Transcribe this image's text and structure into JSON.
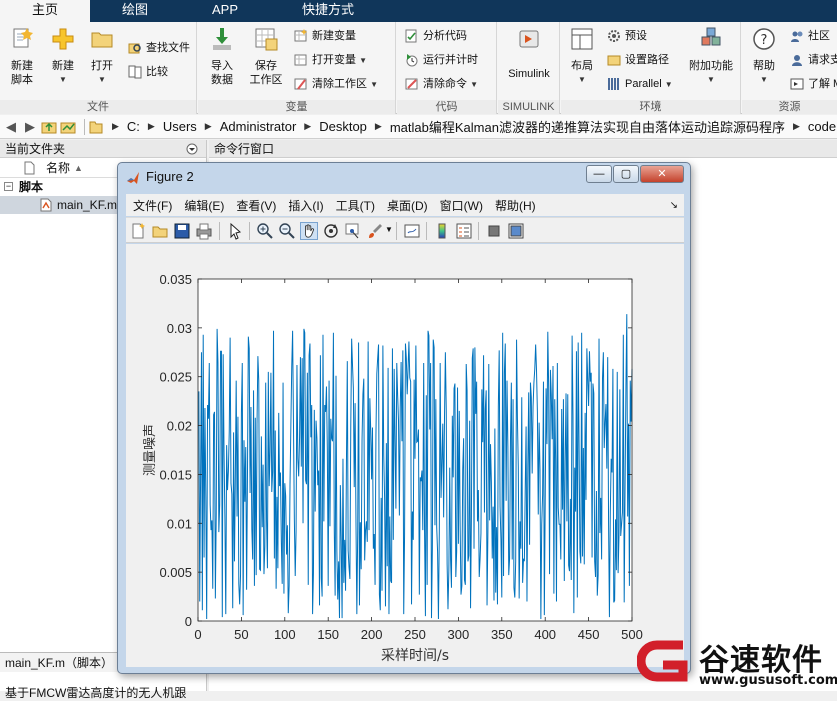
{
  "tabs": [
    "主页",
    "绘图",
    "APP",
    "快捷方式"
  ],
  "ribbon": {
    "file": {
      "label": "文件",
      "new_script": [
        "新建",
        "脚本"
      ],
      "new": "新建",
      "open": "打开",
      "find_files": "查找文件",
      "compare": "比较"
    },
    "variable": {
      "label": "变量",
      "import": [
        "导入",
        "数据"
      ],
      "save_ws": [
        "保存",
        "工作区"
      ],
      "new_var": "新建变量",
      "open_var": "打开变量",
      "clear_ws": "清除工作区"
    },
    "code": {
      "label": "代码",
      "analyze": "分析代码",
      "run_time": "运行并计时",
      "clear_cmd": "清除命令"
    },
    "simulink": {
      "label": "SIMULINK",
      "btn": "Simulink"
    },
    "env": {
      "label": "环境",
      "layout": "布局",
      "prefs": "预设",
      "set_path": "设置路径",
      "parallel": "Parallel",
      "addons": "附加功能"
    },
    "resources": {
      "label": "资源",
      "help": "帮助",
      "community": "社区",
      "request": "请求支",
      "learn": "了解 M"
    }
  },
  "address": [
    "C:",
    "Users",
    "Administrator",
    "Desktop",
    "matlab编程Kalman滤波器的递推算法实现自由落体运动追踪源码程序",
    "code"
  ],
  "current_folder": {
    "title": "当前文件夹",
    "col_name": "名称",
    "col_sort": "▲",
    "group": "脚本",
    "file": "main_KF.m",
    "details_title": "main_KF.m（脚本）",
    "details_text": "基于FMCW雷达高度计的无人机跟"
  },
  "command_window": {
    "title": "命令行窗口"
  },
  "figure": {
    "title": "Figure 2",
    "menus": [
      "文件(F)",
      "编辑(E)",
      "查看(V)",
      "插入(I)",
      "工具(T)",
      "桌面(D)",
      "窗口(W)",
      "帮助(H)"
    ]
  },
  "chart_data": {
    "type": "line",
    "title": "",
    "xlabel": "采样时间/s",
    "ylabel": "测量噪声",
    "xlim": [
      0,
      500
    ],
    "ylim": [
      0,
      0.035
    ],
    "xticks": [
      0,
      50,
      100,
      150,
      200,
      250,
      300,
      350,
      400,
      450,
      500
    ],
    "yticks": [
      0,
      0.005,
      0.01,
      0.015,
      0.02,
      0.025,
      0.03,
      0.035
    ],
    "ytick_labels": [
      "0",
      "0.005",
      "0.01",
      "0.015",
      "0.02",
      "0.025",
      "0.03",
      "0.035"
    ],
    "color": "#0072bd",
    "series": [
      {
        "x_start": 1,
        "x_step": 1,
        "values": [
          0.0235,
          0.002,
          0.015,
          0.0275,
          0.0011,
          0.0293,
          0.0065,
          0.0218,
          0.0127,
          0.0002,
          0.0221,
          0.0207,
          0.0264,
          0.0119,
          0.0093,
          0.0103,
          0.0033,
          0.0211,
          0.0214,
          0.0023,
          0.0109,
          0.0299,
          0.0264,
          0.0091,
          0.0119,
          0.0276,
          0.0276,
          0.0004,
          0.0273,
          0.0172,
          0.0105,
          0.0007,
          0.018,
          0.0134,
          0.0153,
          0.0194,
          0.029,
          0.0141,
          0.013,
          0.0013,
          0.0193,
          0.0061,
          0.0146,
          0.0246,
          0.0107,
          0.0209,
          0.0038,
          0.0017,
          0.0047,
          0.0213,
          0.0264,
          0.0006,
          0.0185,
          0.0122,
          0.0178,
          0.0032,
          0.015,
          0.0291,
          0.0279,
          0.0131,
          0.0219,
          0.0094,
          0.0063,
          0.0236,
          0.0036,
          0.0208,
          0.0047,
          0.0202,
          0.0271,
          0.0246,
          0.0053,
          0.0052,
          0.0189,
          0.0096,
          0.016,
          0.0048,
          0.0076,
          0.0244,
          0.0102,
          0.0054,
          0.0255,
          0.0138,
          0.0173,
          0.0254,
          0.0132,
          0.0153,
          0.0297,
          0.0064,
          0.0195,
          0.0033,
          0.0127,
          0.0054,
          0.0213,
          0.0138,
          0.0152,
          0.0081,
          0.0038,
          0.0244,
          0.0028,
          0.0141,
          0.0128,
          0.0068,
          0.0098,
          0.0008,
          0.0036,
          0.0139,
          0.0201,
          0.026,
          0.0297,
          0.0201,
          0.0104,
          0.0046,
          0.0092,
          0.0262,
          0.0166,
          0.0148,
          0.0188,
          0.027,
          0.0158,
          0.0269,
          0.01,
          0.0299,
          0.0295,
          0.0144,
          0.014,
          0.0254,
          0.0037,
          0.0272,
          0.0284,
          0.0188,
          0.0221,
          0.0007,
          0.0049,
          0.0216,
          0.0112,
          0.0205,
          0.0187,
          0.0139,
          0.0154,
          0.0016,
          0.0272,
          0.0044,
          0.0025,
          0.0293,
          0.0102,
          0.0221,
          0.0214,
          0.024,
          0.0176,
          0.0036,
          0.0246,
          0.0097,
          0.0207,
          0.0187,
          0.0184,
          0.0295,
          0.0092,
          0.0026,
          0.0251,
          0.0071,
          0.0022,
          0.0061,
          0.0003,
          0.0139,
          0.0082,
          0.0003,
          0.0166,
          0.0039,
          0.0083,
          0.0031,
          0.0161,
          0.0266,
          0.0072,
          0.0055,
          0.0043,
          0.0199,
          0.0289,
          0.0262,
          0.0238,
          0.0137,
          0.0223,
          0.0101,
          0.0007,
          0.0092,
          0.0285,
          0.0016,
          0.0101,
          0.0053,
          0.0186,
          0.0232,
          0.0248,
          0.0062,
          0.0093,
          0.0102,
          0.0081,
          0.0286,
          0.0093,
          0.0228,
          0.0195,
          0.0145,
          0.0198,
          0.0074,
          0.0089,
          0.0037,
          0.0191,
          0.0253,
          0.0269,
          0.0283,
          0.0027,
          0.0011,
          0.0126,
          0.0031,
          0.0282,
          0.0169,
          0.0125,
          0.0015,
          0.0182,
          0.0056,
          0.0259,
          0.0007,
          0.0107,
          0.0041,
          0.0039,
          0.0279,
          0.0083,
          0.0258,
          0.0185,
          0.0115,
          0.0264,
          0.0231,
          0.0205,
          0.0108,
          0.0218,
          0.0265,
          0.0184,
          0.0277,
          0.0007,
          0.0089,
          0.0284,
          0.0269,
          0.0232,
          0.0258,
          0.0286,
          0.0249,
          0.0245,
          0.0017,
          0.0112,
          0.0083,
          0.0247,
          0.0166,
          0.0282,
          0.0183,
          0.0184,
          0.0196,
          0.0027,
          0.0147,
          0.0143,
          0.0154,
          0.0093,
          0.0264,
          0.0091,
          0.0005,
          0.0231,
          0.0037,
          0.0297,
          0.0292,
          0.0196,
          0.0264,
          0.0003,
          0.0074,
          0.0288,
          0.028,
          0.0098,
          0.0227,
          0.0096,
          0.0071,
          0.0002,
          0.009,
          0.0264,
          0.0126,
          0.0163,
          0.0202,
          0.0106,
          0.0209,
          0.0275,
          0.0216,
          0.0058,
          0.0012,
          0.0052,
          0.0157,
          0.0063,
          0.0034,
          0.021,
          0.0147,
          0.0238,
          0.0243,
          0.0045,
          0.0071,
          0.0239,
          0.0079,
          0.0215,
          0.0097,
          0.0027,
          0.0036,
          0.0155,
          0.0187,
          0.0042,
          0.0037,
          0.0263,
          0.0236,
          0.0061,
          0.0067,
          0.0205,
          0.0013,
          0.0108,
          0.0269,
          0.0279,
          0.0074,
          0.028,
          0.0212,
          0.0245,
          0.0102,
          0.0134,
          0.0045,
          0.0064,
          0.009,
          0.0237,
          0.0183,
          0.0272,
          0.0111,
          0.0217,
          0.0236,
          0.0016,
          0.0091,
          0.0263,
          0.0103,
          0.0181,
          0.0142,
          0.0064,
          0.0117,
          0.0021,
          0.0197,
          0.0029,
          0.0096,
          0.0017,
          0.0219,
          0.0277,
          0.0117,
          0.0084,
          0.0024,
          0.0295,
          0.0046,
          0.0254,
          0.0284,
          0.0123,
          0.0246,
          0.0179,
          0.0047,
          0.0064,
          0.0186,
          0.0244,
          0.0063,
          0.0227,
          0.0034,
          0.0024,
          0.0061,
          0.0288,
          0.0207,
          0.0158,
          0.0023,
          0.0102,
          0.0074,
          0.0229,
          0.0039,
          0.0063,
          0.0062,
          0.0136,
          0.0199,
          0.002,
          0.0159,
          0.0234,
          0.0078,
          0.0244,
          0.0229,
          0.0151,
          0.0219,
          0.0244,
          0.0258,
          0.0283,
          0.0256,
          0.0214,
          0.0109,
          0.0203,
          0.0155,
          0.0002,
          0.0099,
          0.0129,
          0.0245,
          0.0006,
          0.0121,
          0.0238,
          0.0181,
          0.0296,
          0.0239,
          0.0048,
          0.0257,
          0.0232,
          0.0186,
          0.0261,
          0.0028,
          0.0227,
          0.0166,
          0.002,
          0.0264,
          0.0116,
          0.0099,
          0.0099,
          0.0063,
          0.0217,
          0.0114,
          0.0227,
          0.0041,
          0.0163,
          0.0233,
          0.0102,
          0.0232,
          0.0057,
          0.0051,
          0.0125,
          0.0042,
          0.0292,
          0.0211,
          0.0008,
          0.0157,
          0.0112,
          0.0276,
          0.0024,
          0.0285,
          0.0182,
          0.0071,
          0.0059,
          0.0295,
          0.0066,
          0.0177,
          0.0058,
          0.0213,
          0.0124,
          0.0279,
          0.0247,
          0.022,
          0.0276,
          0.0245,
          0.0254,
          0.0065,
          0.0243,
          0.0233,
          0.0061,
          0.0045,
          0.0133,
          0.0026,
          0.0047,
          0.0289,
          0.009,
          0.0126,
          0.0063,
          0.0248,
          0.0275,
          0.0177,
          0.0204,
          0.0222,
          0.0156,
          0.027,
          0.0101,
          0.0004,
          0.0112,
          0.0166,
          0.0152,
          0.0258,
          0.0019,
          0.0021,
          0.0104,
          0.0052,
          0.0255,
          0.0049,
          0.0087,
          0.0237,
          0.0087,
          0.0099,
          0.0111,
          0.0293,
          0.0019,
          0.0136,
          0.0239,
          0.0314,
          0.0107,
          0.0202,
          0.0036,
          0.0246,
          0.0204,
          0.0258
        ]
      }
    ]
  },
  "watermark": {
    "brand": "谷速软件",
    "url": "www.gususoft.com"
  }
}
